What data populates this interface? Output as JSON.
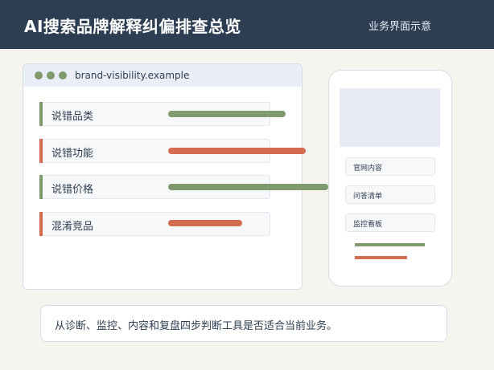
{
  "header": {
    "title": "AI搜索品牌解释纠偏排查总览",
    "subtitle": "业务界面示意"
  },
  "browser": {
    "url": "brand-visibility.example",
    "rows": [
      {
        "label": "说错品类",
        "status": "green",
        "level": 0.52
      },
      {
        "label": "说错功能",
        "status": "red",
        "level": 0.61
      },
      {
        "label": "说错价格",
        "status": "green",
        "level": 0.71
      },
      {
        "label": "混淆竞品",
        "status": "red",
        "level": 0.33
      }
    ]
  },
  "phone": {
    "buttons": [
      {
        "label": "官网内容"
      },
      {
        "label": "问答清单"
      },
      {
        "label": "监控看板"
      }
    ]
  },
  "note": {
    "text": "从诊断、监控、内容和复盘四步判断工具是否适合当前业务。"
  },
  "colors": {
    "header_bg": "#2e3e52",
    "green": "#7f9a6c",
    "red": "#d46d4f",
    "page_bg": "#f5f4ef"
  }
}
